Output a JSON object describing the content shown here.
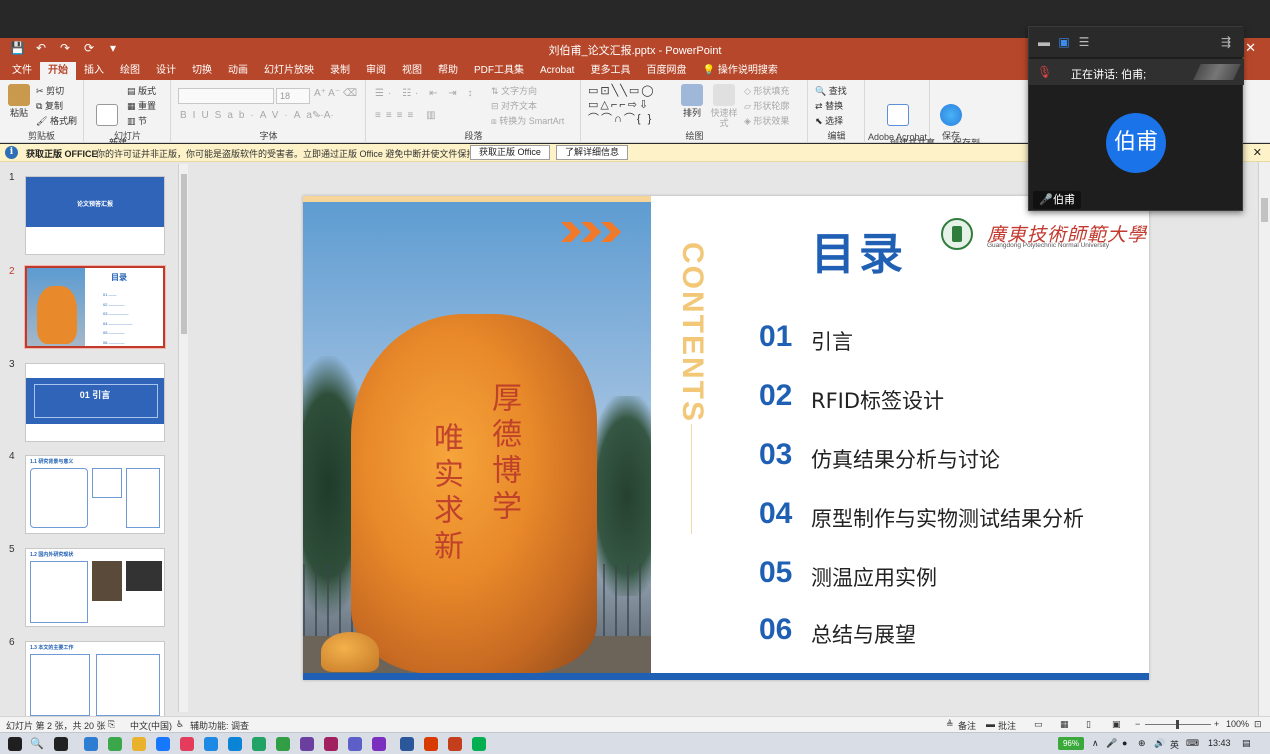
{
  "app": {
    "doc_title": "刘伯甫_论文汇报.pptx - PowerPoint",
    "quick_access": [
      "💾",
      "↶",
      "↷",
      "⟳",
      "▾"
    ],
    "close_glyph": "✕"
  },
  "menu": [
    {
      "label": "文件",
      "active": false
    },
    {
      "label": "开始",
      "active": true
    },
    {
      "label": "插入",
      "active": false
    },
    {
      "label": "绘图",
      "active": false
    },
    {
      "label": "设计",
      "active": false
    },
    {
      "label": "切换",
      "active": false
    },
    {
      "label": "动画",
      "active": false
    },
    {
      "label": "幻灯片放映",
      "active": false
    },
    {
      "label": "录制",
      "active": false
    },
    {
      "label": "审阅",
      "active": false
    },
    {
      "label": "视图",
      "active": false
    },
    {
      "label": "帮助",
      "active": false
    },
    {
      "label": "PDF工具集",
      "active": false
    },
    {
      "label": "Acrobat",
      "active": false
    },
    {
      "label": "更多工具",
      "active": false
    },
    {
      "label": "百度网盘",
      "active": false
    },
    {
      "label": "操作说明搜索",
      "active": false
    }
  ],
  "ribbon": {
    "clipboard": {
      "label": "剪贴板",
      "paste": "粘贴",
      "cut": "剪切",
      "copy": "复制",
      "format_painter": "格式刷"
    },
    "slides": {
      "label": "幻灯片",
      "new_slide": "新建\n幻灯片",
      "layout": "版式",
      "reset": "重置",
      "section": "节"
    },
    "font": {
      "label": "字体",
      "size": "18"
    },
    "paragraph": {
      "label": "段落",
      "text_dir": "文字方向",
      "align_text": "对齐文本",
      "smartart": "转换为 SmartArt"
    },
    "drawing": {
      "label": "绘图",
      "arrange": "排列",
      "quick_styles": "快速样式",
      "fill": "形状填充",
      "outline": "形状轮廓",
      "effects": "形状效果"
    },
    "editing": {
      "label": "编辑",
      "find": "查找",
      "replace": "替换",
      "select": "选择"
    },
    "acrobat": {
      "label": "Adobe Acrobat",
      "create": "创建并共享\nAdobe PDF"
    },
    "save": {
      "label": "保存",
      "baidu": "保存到\n百度网盘"
    }
  },
  "notice": {
    "title": "获取正版 OFFICE",
    "text": "你的许可证并非正版，你可能是盗版软件的受害者。立即通过正版 Office 避免中断并使文件保持安全。",
    "btn_get": "获取正版 Office",
    "btn_learn": "了解详细信息"
  },
  "thumbnails": [
    {
      "num": "1",
      "title": "论文预答汇报",
      "selected": false
    },
    {
      "num": "2",
      "title": "目录",
      "selected": true
    },
    {
      "num": "3",
      "title": "01 引言",
      "selected": false
    },
    {
      "num": "4",
      "title": "1.1 研究背景与意义",
      "selected": false
    },
    {
      "num": "5",
      "title": "1.2 国内外研究现状",
      "selected": false
    },
    {
      "num": "6",
      "title": "1.3 本文的主要工作",
      "selected": false
    }
  ],
  "slide": {
    "title": "目录",
    "contents_word": "CONTENTS",
    "university_cn": "廣東技術師範大學",
    "university_en": "Guangdong Polytechnic Normal University",
    "rock_text_1": "厚德博学",
    "rock_text_2": "唯实求新",
    "toc": [
      {
        "num": "01",
        "text": "引言"
      },
      {
        "num": "02",
        "text": "RFID标签设计"
      },
      {
        "num": "03",
        "text": "仿真结果分析与讨论"
      },
      {
        "num": "04",
        "text": "原型制作与实物测试结果分析"
      },
      {
        "num": "05",
        "text": "测温应用实例"
      },
      {
        "num": "06",
        "text": "总结与展望"
      }
    ]
  },
  "status": {
    "slide_pos": "幻灯片 第 2 张，共 20 张",
    "language": "中文(中国)",
    "accessibility": "辅助功能: 调查",
    "notes": "备注",
    "comments": "批注",
    "zoom": "100%"
  },
  "meeting": {
    "speaking": "正在讲话: 伯甫;",
    "avatar_name": "伯甫",
    "name_tag": "伯甫"
  },
  "taskbar": {
    "battery": "96%",
    "ime": "英",
    "time": "13:43"
  },
  "colors": {
    "ppt_red": "#b7472a",
    "slide_blue": "#1f5fb4",
    "avatar_blue": "#1a73e8"
  }
}
